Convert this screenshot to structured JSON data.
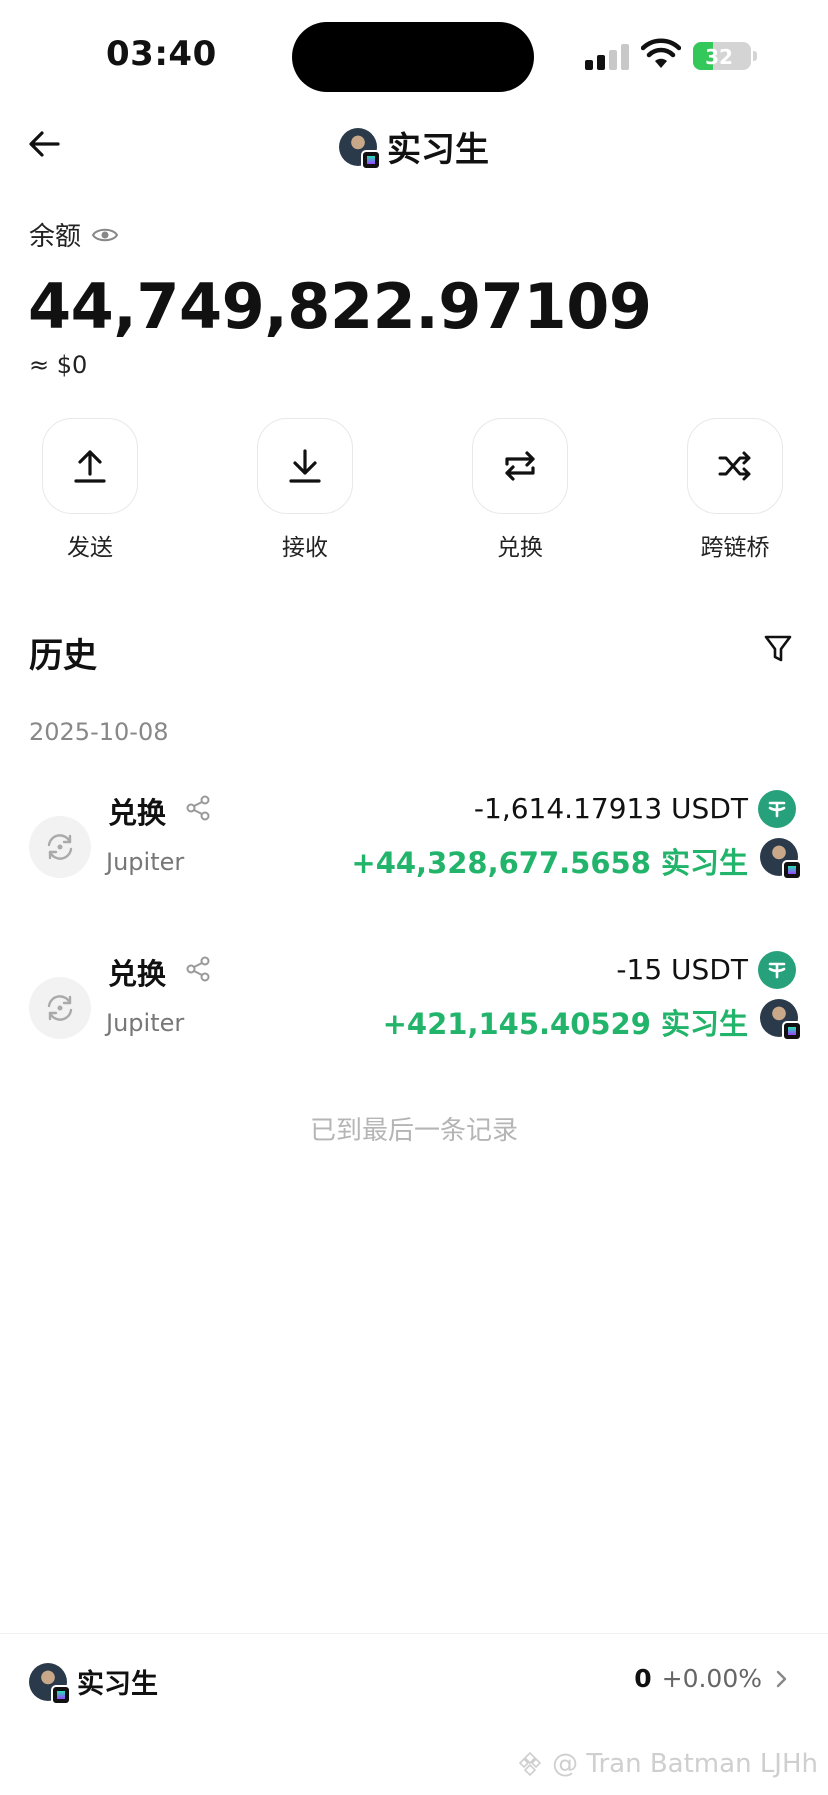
{
  "status_bar": {
    "time": "03:40",
    "battery": "32"
  },
  "header": {
    "title": "实习生"
  },
  "balance": {
    "label": "余额",
    "amount": "44,749,822.97109",
    "usd": "≈ $0"
  },
  "actions": [
    {
      "label": "发送",
      "icon": "upload-icon"
    },
    {
      "label": "接收",
      "icon": "download-icon"
    },
    {
      "label": "兑换",
      "icon": "swap-icon"
    },
    {
      "label": "跨链桥",
      "icon": "shuffle-icon"
    }
  ],
  "history": {
    "title": "历史",
    "date": "2025-10-08",
    "transactions": [
      {
        "type": "兑换",
        "source": "Jupiter",
        "out": "-1,614.17913 USDT",
        "in": "+44,328,677.5658 实习生"
      },
      {
        "type": "兑换",
        "source": "Jupiter",
        "out": "-15 USDT",
        "in": "+421,145.40529 实习生"
      }
    ],
    "end_note": "已到最后一条记录"
  },
  "bottom_bar": {
    "name": "实习生",
    "value": "0",
    "change": "+0.00%"
  },
  "watermark": "@ Tran Batman LJHh",
  "colors": {
    "green": "#22b46a",
    "usdt": "#26a17b",
    "battery": "#34c759"
  }
}
